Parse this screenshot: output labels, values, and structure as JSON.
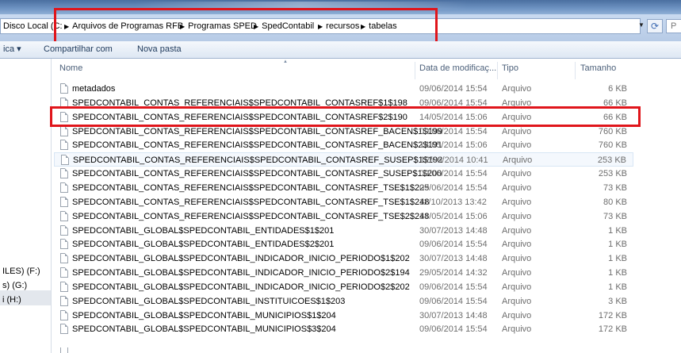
{
  "address": {
    "drive_label": "Disco Local (C:",
    "crumbs": [
      "Arquivos de Programas RFB",
      "Programas SPED",
      "SpedContabil",
      "recursos",
      "tabelas"
    ],
    "search_placeholder": "P"
  },
  "toolbar": {
    "organize_label": "ica ▾",
    "share_label": "Compartilhar com",
    "new_folder_label": "Nova pasta"
  },
  "nav": {
    "items": [
      "ILES) (F:)",
      "s) (G:)",
      "i (H:)"
    ]
  },
  "columns": {
    "name": "Nome",
    "date": "Data de modificaç...",
    "type": "Tipo",
    "size": "Tamanho"
  },
  "files": [
    {
      "name": "metadados",
      "date": "09/06/2014 15:54",
      "type": "Arquivo",
      "size": "6 KB"
    },
    {
      "name": "SPEDCONTABIL_CONTAS_REFERENCIAIS$SPEDCONTABIL_CONTASREF$1$198",
      "date": "09/06/2014 15:54",
      "type": "Arquivo",
      "size": "66 KB"
    },
    {
      "name": "SPEDCONTABIL_CONTAS_REFERENCIAIS$SPEDCONTABIL_CONTASREF$2$190",
      "date": "14/05/2014 15:06",
      "type": "Arquivo",
      "size": "66 KB"
    },
    {
      "name": "SPEDCONTABIL_CONTAS_REFERENCIAIS$SPEDCONTABIL_CONTASREF_BACEN$1$199",
      "date": "09/06/2014 15:54",
      "type": "Arquivo",
      "size": "760 KB"
    },
    {
      "name": "SPEDCONTABIL_CONTAS_REFERENCIAIS$SPEDCONTABIL_CONTASREF_BACEN$2$191",
      "date": "14/05/2014 15:06",
      "type": "Arquivo",
      "size": "760 KB"
    },
    {
      "name": "SPEDCONTABIL_CONTAS_REFERENCIAIS$SPEDCONTABIL_CONTASREF_SUSEP$1$192",
      "date": "12/06/2014 10:41",
      "type": "Arquivo",
      "size": "253 KB"
    },
    {
      "name": "SPEDCONTABIL_CONTAS_REFERENCIAIS$SPEDCONTABIL_CONTASREF_SUSEP$1$200",
      "date": "09/06/2014 15:54",
      "type": "Arquivo",
      "size": "253 KB"
    },
    {
      "name": "SPEDCONTABIL_CONTAS_REFERENCIAIS$SPEDCONTABIL_CONTASREF_TSE$1$225",
      "date": "09/06/2014 15:54",
      "type": "Arquivo",
      "size": "73 KB"
    },
    {
      "name": "SPEDCONTABIL_CONTAS_REFERENCIAIS$SPEDCONTABIL_CONTASREF_TSE$1$248",
      "date": "11/10/2013 13:42",
      "type": "Arquivo",
      "size": "80 KB"
    },
    {
      "name": "SPEDCONTABIL_CONTAS_REFERENCIAIS$SPEDCONTABIL_CONTASREF_TSE$2$248",
      "date": "14/05/2014 15:06",
      "type": "Arquivo",
      "size": "73 KB"
    },
    {
      "name": "SPEDCONTABIL_GLOBAL$SPEDCONTABIL_ENTIDADES$1$201",
      "date": "30/07/2013 14:48",
      "type": "Arquivo",
      "size": "1 KB"
    },
    {
      "name": "SPEDCONTABIL_GLOBAL$SPEDCONTABIL_ENTIDADES$2$201",
      "date": "09/06/2014 15:54",
      "type": "Arquivo",
      "size": "1 KB"
    },
    {
      "name": "SPEDCONTABIL_GLOBAL$SPEDCONTABIL_INDICADOR_INICIO_PERIODO$1$202",
      "date": "30/07/2013 14:48",
      "type": "Arquivo",
      "size": "1 KB"
    },
    {
      "name": "SPEDCONTABIL_GLOBAL$SPEDCONTABIL_INDICADOR_INICIO_PERIODO$2$194",
      "date": "29/05/2014 14:32",
      "type": "Arquivo",
      "size": "1 KB"
    },
    {
      "name": "SPEDCONTABIL_GLOBAL$SPEDCONTABIL_INDICADOR_INICIO_PERIODO$2$202",
      "date": "09/06/2014 15:54",
      "type": "Arquivo",
      "size": "1 KB"
    },
    {
      "name": "SPEDCONTABIL_GLOBAL$SPEDCONTABIL_INSTITUICOES$1$203",
      "date": "09/06/2014 15:54",
      "type": "Arquivo",
      "size": "3 KB"
    },
    {
      "name": "SPEDCONTABIL_GLOBAL$SPEDCONTABIL_MUNICIPIOS$1$204",
      "date": "30/07/2013 14:48",
      "type": "Arquivo",
      "size": "172 KB"
    },
    {
      "name": "SPEDCONTABIL_GLOBAL$SPEDCONTABIL_MUNICIPIOS$3$204",
      "date": "09/06/2014 15:54",
      "type": "Arquivo",
      "size": "172 KB"
    }
  ],
  "colors": {
    "highlight_box": "#e0151b",
    "toolbar_text": "#1e395b"
  }
}
